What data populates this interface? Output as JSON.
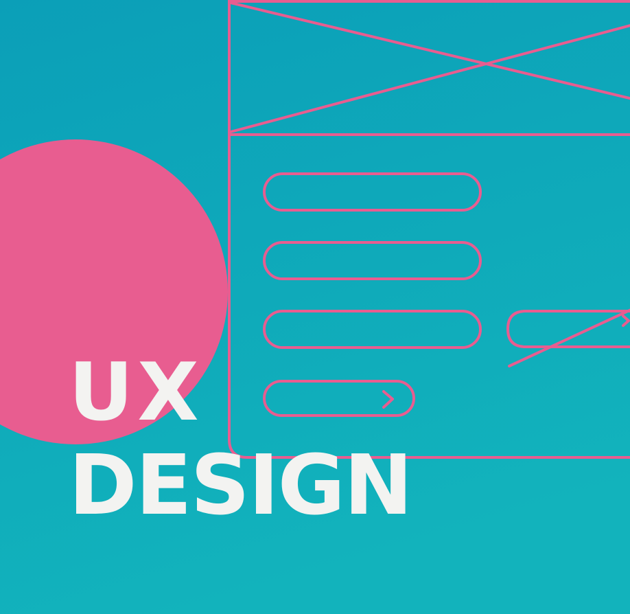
{
  "headline": {
    "line1": "UX",
    "line2": "DESIGN"
  },
  "colors": {
    "background_top": "#0da3b8",
    "background_bottom": "#10b1bb",
    "accent_pink": "#e85d90",
    "text_white": "#f3f3f1"
  },
  "wireframe": {
    "image_placeholder": "crossed-box-icon",
    "fields": [
      "pill-field",
      "pill-field",
      "pill-field"
    ],
    "button_icon": "chevron-right-icon",
    "broken_element": "crossed-pill-icon"
  }
}
